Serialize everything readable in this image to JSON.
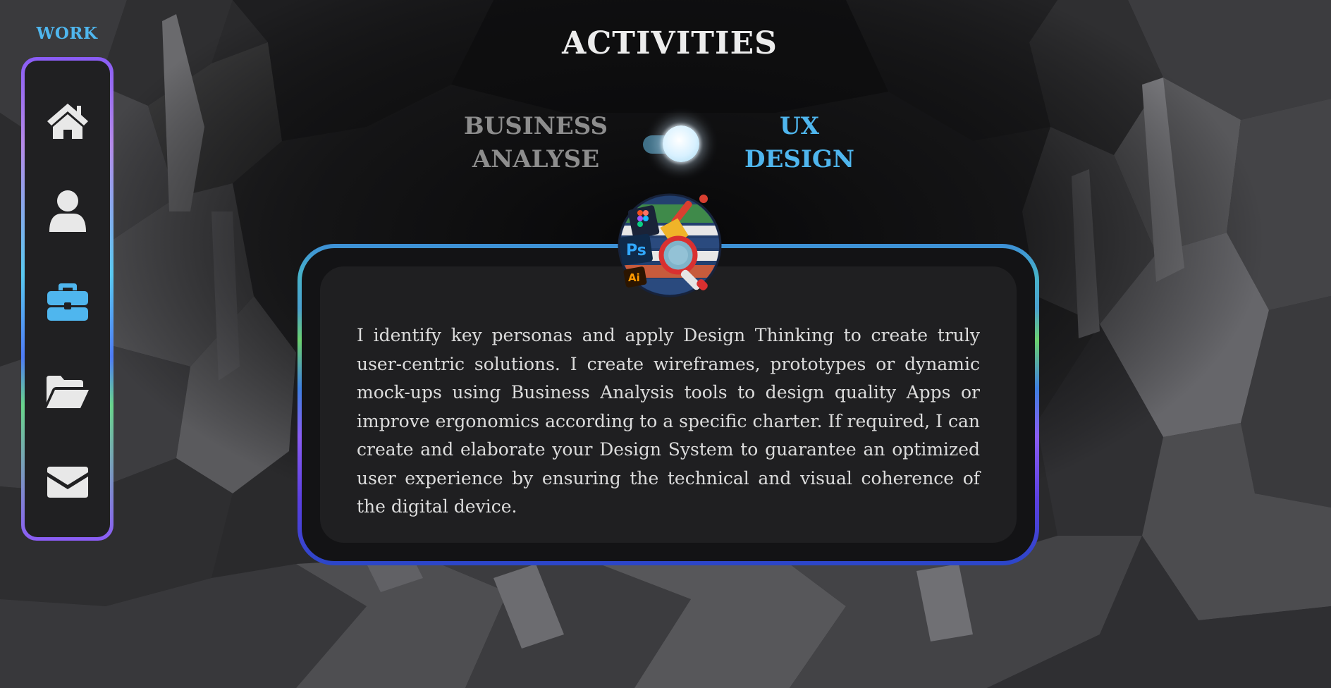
{
  "sidebar": {
    "label": "WORK",
    "items": [
      {
        "name": "home",
        "icon": "home-icon",
        "active": false
      },
      {
        "name": "profile",
        "icon": "user-icon",
        "active": false
      },
      {
        "name": "work",
        "icon": "briefcase-icon",
        "active": true
      },
      {
        "name": "portfolio",
        "icon": "folder-open-icon",
        "active": false
      },
      {
        "name": "contact",
        "icon": "envelope-icon",
        "active": false
      }
    ]
  },
  "header": {
    "title": "ACTIVITIES"
  },
  "toggle": {
    "left_line1": "BUSINESS",
    "left_line2": "ANALYSE",
    "right_line1": "UX",
    "right_line2": "DESIGN",
    "selected": "right"
  },
  "card": {
    "icon": "ux-design-tools-icon",
    "badge_texts": {
      "ps": "Ps",
      "ai": "Ai"
    },
    "text": "I identify key personas and apply Design Thinking to create truly user-centric solutions. I create wireframes, prototypes or dynamic mock-ups using Business Analysis tools to design quality Apps or improve ergonomics according to a specific charter. If required, I can create and elaborate your Design System to guarantee an optimized user experience by ensuring the technical and visual coherence of the digital device."
  },
  "colors": {
    "accent": "#4fb6ee",
    "inactive_label": "#8d8d8d",
    "nav_icon": "#e8e8e8",
    "card_bg": "#1f1f21"
  }
}
